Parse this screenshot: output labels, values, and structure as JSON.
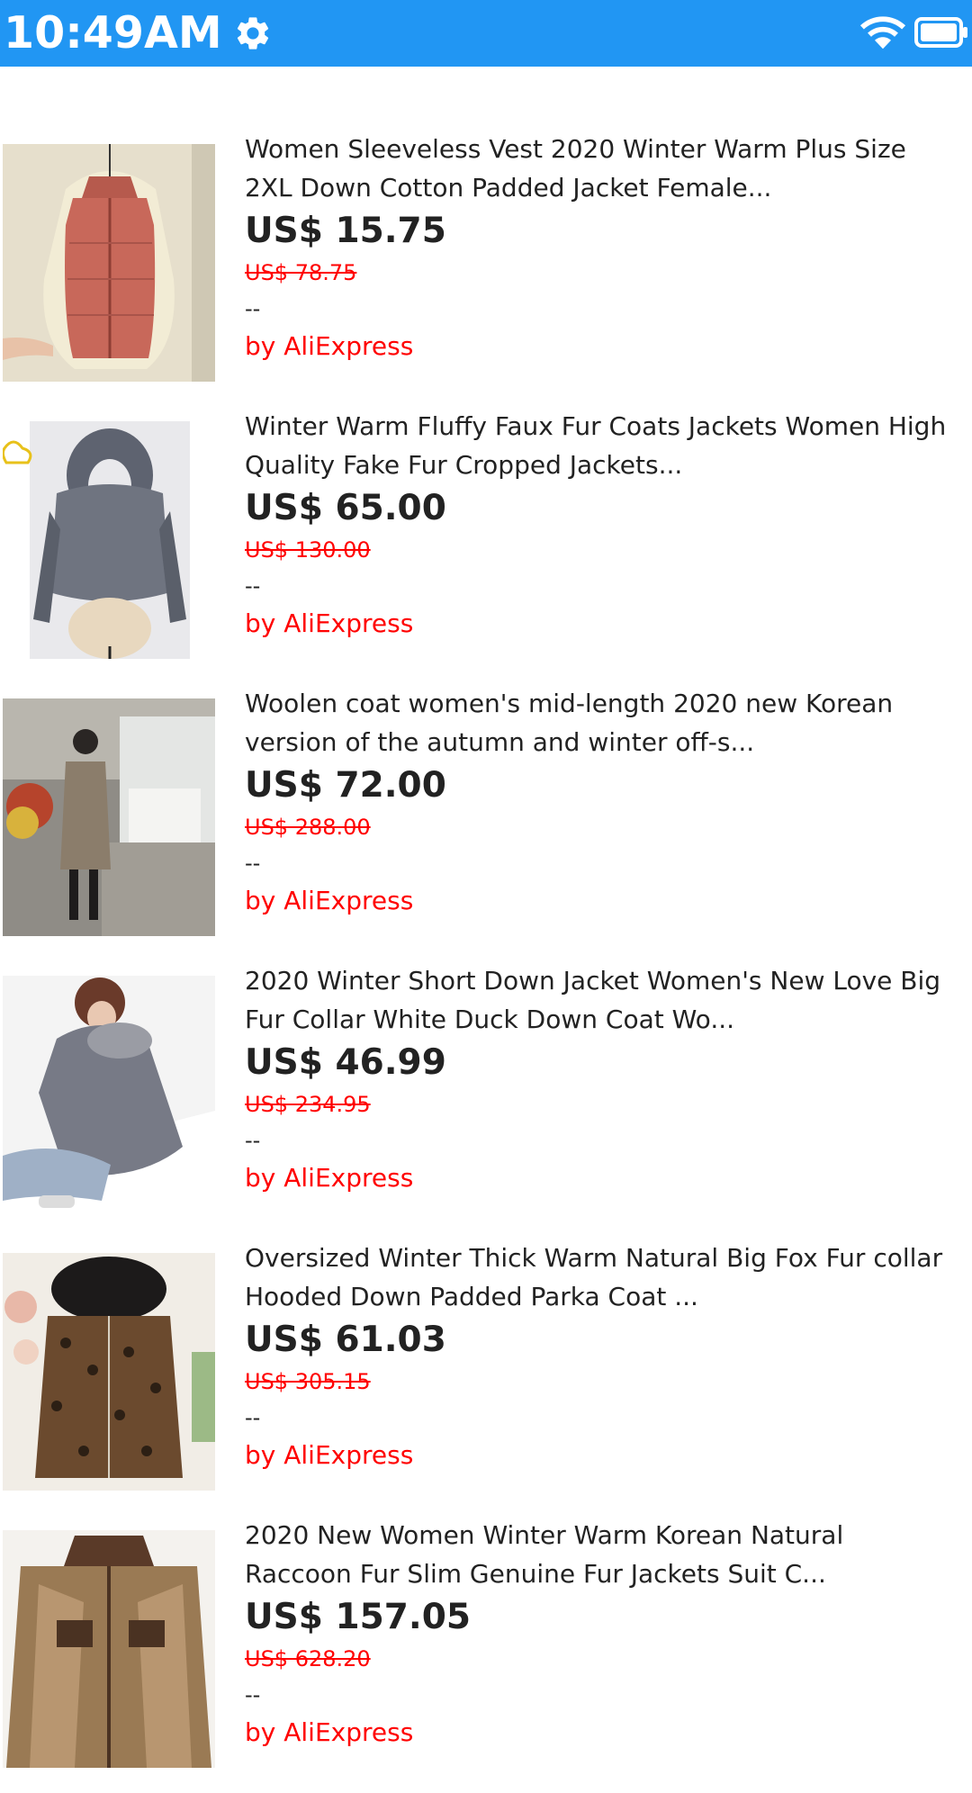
{
  "status_bar": {
    "time": "10:49AM",
    "settings_icon": "gear-icon",
    "wifi_icon": "wifi-icon",
    "battery_icon": "battery-icon",
    "color": "#2196f3"
  },
  "products": [
    {
      "title_line1": "Women Sleeveless Vest 2020 Winter Warm Plus Size",
      "title_line2": "2XL Down Cotton Padded Jacket Female...",
      "price": "US$ 15.75",
      "old_price": "US$ 78.75",
      "rating": "--",
      "seller": "by AliExpress"
    },
    {
      "title_line1": "Winter Warm Fluffy Faux Fur Coats Jackets Women High",
      "title_line2": "Quality Fake Fur Cropped Jackets...",
      "price": "US$ 65.00",
      "old_price": "US$ 130.00",
      "rating": "--",
      "seller": "by AliExpress"
    },
    {
      "title_line1": "Woolen coat women's mid-length 2020 new Korean",
      "title_line2": "version of the autumn and winter off-s...",
      "price": "US$ 72.00",
      "old_price": "US$ 288.00",
      "rating": "--",
      "seller": "by AliExpress"
    },
    {
      "title_line1": "2020 Winter Short Down Jacket Women's New Love Big",
      "title_line2": "Fur Collar White Duck Down Coat Wo...",
      "price": "US$ 46.99",
      "old_price": "US$ 234.95",
      "rating": "--",
      "seller": "by AliExpress"
    },
    {
      "title_line1": "Oversized Winter Thick Warm Natural Big Fox Fur collar",
      "title_line2": "Hooded Down Padded Parka Coat ...",
      "price": "US$ 61.03",
      "old_price": "US$ 305.15",
      "rating": "--",
      "seller": "by AliExpress"
    },
    {
      "title_line1": "2020 New Women Winter Warm Korean Natural",
      "title_line2": "Raccoon Fur Slim Genuine Fur Jackets Suit C...",
      "price": "US$ 157.05",
      "old_price": "US$ 628.20",
      "rating": "--",
      "seller": "by AliExpress"
    }
  ]
}
